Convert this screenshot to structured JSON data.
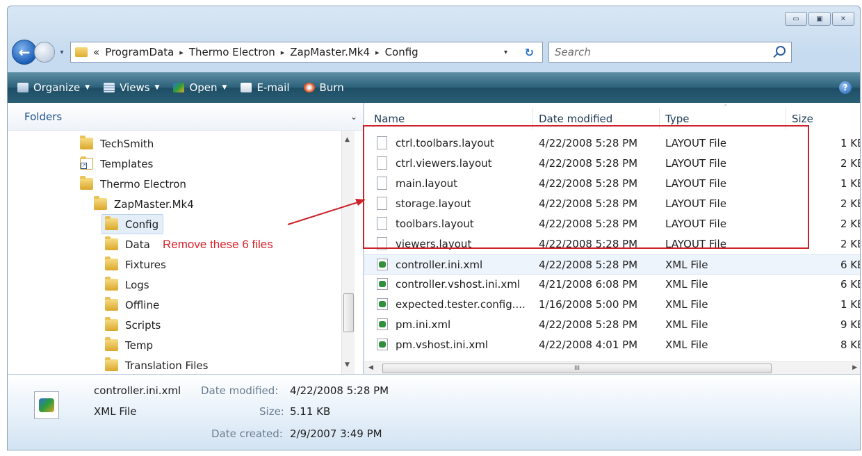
{
  "window": {
    "caption_buttons": [
      "▭",
      "▣",
      "✕"
    ]
  },
  "address_bar": {
    "prefix": "«",
    "crumbs": [
      "ProgramData",
      "Thermo Electron",
      "ZapMaster.Mk4",
      "Config"
    ],
    "separator": "▸",
    "dropdown": "▾",
    "refresh": "↻"
  },
  "search": {
    "placeholder": "Search"
  },
  "toolbar": {
    "organize": "Organize",
    "views": "Views",
    "open": "Open",
    "email": "E-mail",
    "burn": "Burn",
    "help": "?"
  },
  "folders_pane": {
    "header": "Folders",
    "header_chevron": "⌄",
    "items": [
      {
        "label": "TechSmith",
        "indent": 0
      },
      {
        "label": "Templates",
        "indent": 0,
        "shortcut": true
      },
      {
        "label": "Thermo Electron",
        "indent": 0
      },
      {
        "label": "ZapMaster.Mk4",
        "indent": 1
      },
      {
        "label": "Config",
        "indent": 2,
        "selected": true
      },
      {
        "label": "Data",
        "indent": 2
      },
      {
        "label": "Fixtures",
        "indent": 2
      },
      {
        "label": "Logs",
        "indent": 2
      },
      {
        "label": "Offline",
        "indent": 2
      },
      {
        "label": "Scripts",
        "indent": 2
      },
      {
        "label": "Temp",
        "indent": 2
      },
      {
        "label": "Translation Files",
        "indent": 2
      }
    ]
  },
  "file_list": {
    "columns": [
      "Name",
      "Date modified",
      "Type",
      "Size"
    ],
    "rows": [
      {
        "name": "ctrl.toolbars.layout",
        "date": "4/22/2008 5:28 PM",
        "type": "LAYOUT File",
        "size": "1 KE",
        "icon": "file"
      },
      {
        "name": "ctrl.viewers.layout",
        "date": "4/22/2008 5:28 PM",
        "type": "LAYOUT File",
        "size": "2 KE",
        "icon": "file"
      },
      {
        "name": "main.layout",
        "date": "4/22/2008 5:28 PM",
        "type": "LAYOUT File",
        "size": "1 KE",
        "icon": "file"
      },
      {
        "name": "storage.layout",
        "date": "4/22/2008 5:28 PM",
        "type": "LAYOUT File",
        "size": "2 KE",
        "icon": "file"
      },
      {
        "name": "toolbars.layout",
        "date": "4/22/2008 5:28 PM",
        "type": "LAYOUT File",
        "size": "2 KE",
        "icon": "file"
      },
      {
        "name": "viewers.layout",
        "date": "4/22/2008 5:28 PM",
        "type": "LAYOUT File",
        "size": "2 KE",
        "icon": "file"
      },
      {
        "name": "controller.ini.xml",
        "date": "4/22/2008 5:28 PM",
        "type": "XML File",
        "size": "6 KE",
        "icon": "xml",
        "highlight": true
      },
      {
        "name": "controller.vshost.ini.xml",
        "date": "4/21/2008 6:08 PM",
        "type": "XML File",
        "size": "6 KE",
        "icon": "xml"
      },
      {
        "name": "expected.tester.config....",
        "date": "1/16/2008 5:00 PM",
        "type": "XML File",
        "size": "1 KE",
        "icon": "xml"
      },
      {
        "name": "pm.ini.xml",
        "date": "4/22/2008 5:28 PM",
        "type": "XML File",
        "size": "9 KE",
        "icon": "xml"
      },
      {
        "name": "pm.vshost.ini.xml",
        "date": "4/22/2008 4:01 PM",
        "type": "XML File",
        "size": "8 KE",
        "icon": "xml"
      }
    ],
    "hscroll_grip": "III"
  },
  "details": {
    "filename": "controller.ini.xml",
    "filetype": "XML File",
    "date_modified_label": "Date modified:",
    "date_modified": "4/22/2008 5:28 PM",
    "size_label": "Size:",
    "size": "5.11 KB",
    "date_created_label": "Date created:",
    "date_created": "2/9/2007 3:49 PM"
  },
  "annotation": {
    "text": "Remove these 6 files",
    "color": "#cc2229"
  }
}
